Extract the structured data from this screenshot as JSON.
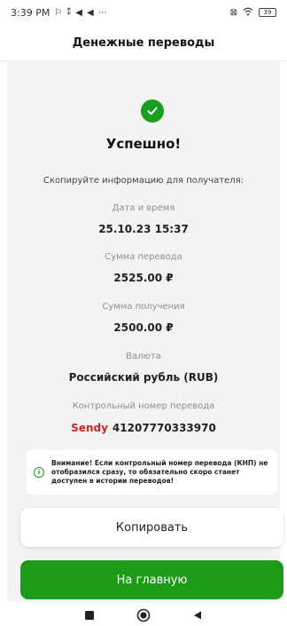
{
  "status_bar": {
    "time": "3:39 PM",
    "left_icons": [
      "notification-icon",
      "signal-icon",
      "send-icon",
      "send-icon",
      "more-icon"
    ],
    "battery": "39"
  },
  "app_bar": {
    "title": "Денежные переводы"
  },
  "success": {
    "icon": "checkmark-icon",
    "heading": "Успешно!",
    "hint": "Скопируйте информацию для получателя:"
  },
  "details": [
    {
      "label": "Дата и время",
      "value": "25.10.23 15:37"
    },
    {
      "label": "Сумма перевода",
      "value": "2525.00 ₽"
    },
    {
      "label": "Сумма получения",
      "value": "2500.00 ₽"
    },
    {
      "label": "Валюта",
      "value": "Российский рубль (RUB)"
    }
  ],
  "control_number": {
    "label": "Контрольный номер перевода",
    "brand": "Sendy",
    "value": "41207770333970"
  },
  "notice": {
    "icon": "info-icon",
    "text": "Внимание! Если контрольный номер перевода (КНП) не отобразился сразу, то обязательно скоро станет доступен в истории переводов!"
  },
  "buttons": {
    "copy": "Копировать",
    "home": "На главную"
  },
  "nav_bar": {
    "icons": [
      "recents-square-icon",
      "home-circle-icon",
      "back-triangle-icon"
    ]
  },
  "colors": {
    "accent_green": "#1d9a17",
    "brand_red": "#c62828",
    "background": "#f3f3f3"
  }
}
